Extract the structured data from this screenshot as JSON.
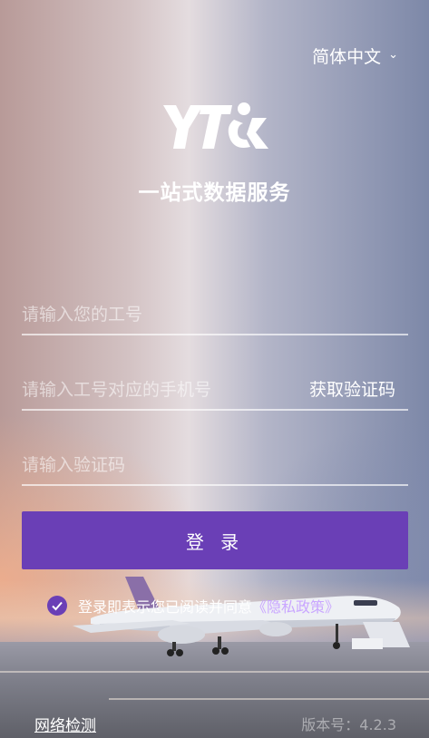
{
  "header": {
    "language_label": "简体中文"
  },
  "brand": {
    "logo_text": "YTO",
    "tagline": "一站式数据服务"
  },
  "form": {
    "employee_id_placeholder": "请输入您的工号",
    "phone_placeholder": "请输入工号对应的手机号",
    "get_code_label": "获取验证码",
    "code_placeholder": "请输入验证码",
    "login_label": "登 录"
  },
  "agreement": {
    "text": "登录即表示您已阅读并同意",
    "policy_link": "《隐私政策》",
    "checked": true
  },
  "footer": {
    "network_check_label": "网络检测",
    "version_text": "版本号：4.2.3"
  },
  "colors": {
    "accent": "#6a3fb6",
    "link": "#c9a6ff"
  }
}
